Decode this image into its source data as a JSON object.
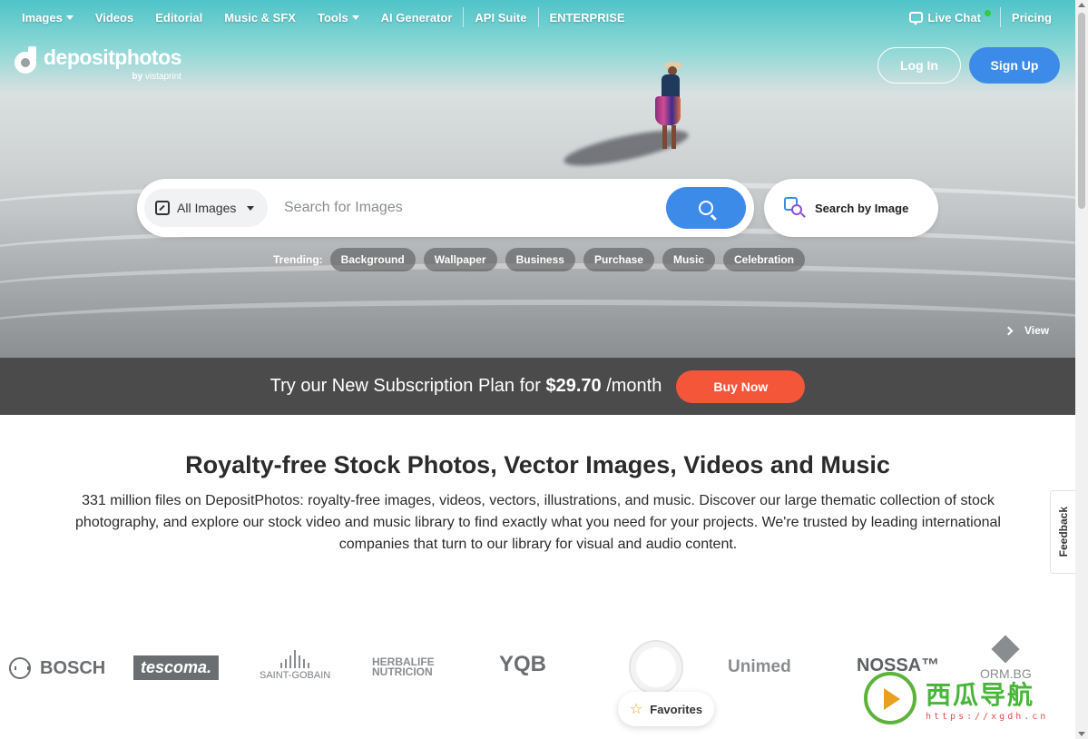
{
  "nav": {
    "items": [
      {
        "label": "Images",
        "dropdown": true
      },
      {
        "label": "Videos",
        "dropdown": false
      },
      {
        "label": "Editorial",
        "dropdown": false
      },
      {
        "label": "Music & SFX",
        "dropdown": false
      },
      {
        "label": "Tools",
        "dropdown": true
      },
      {
        "label": "AI Generator",
        "dropdown": false
      },
      {
        "label": "API Suite",
        "dropdown": false
      },
      {
        "label": "ENTERPRISE",
        "dropdown": false
      }
    ],
    "live_chat": "Live Chat",
    "pricing": "Pricing"
  },
  "logo": {
    "name": "depositphotos",
    "by": "by",
    "partner": "vistaprint"
  },
  "auth": {
    "login": "Log In",
    "signup": "Sign Up"
  },
  "search": {
    "scope": "All Images",
    "placeholder": "Search for Images",
    "by_image": "Search by Image"
  },
  "trending": {
    "label": "Trending:",
    "chips": [
      "Background",
      "Wallpaper",
      "Business",
      "Purchase",
      "Music",
      "Celebration"
    ]
  },
  "hero": {
    "view_label": "View"
  },
  "promo": {
    "text": "Try our New Subscription Plan for",
    "price": "$29.70",
    "period": "/month",
    "button": "Buy Now"
  },
  "main": {
    "headline": "Royalty-free Stock Photos, Vector Images, Videos and Music",
    "intro": "331 million files on DepositPhotos: royalty-free images, videos, vectors, illustrations, and music. Discover our large thematic collection of stock photography, and explore our stock video and music library to find exactly what you need for your projects. We're trusted by leading international companies that turn to our library for visual and audio content."
  },
  "brands": {
    "bosch": "BOSCH",
    "tescoma": "tescoma.",
    "saint_gobain": "SAINT-GOBAIN",
    "herbalife_1": "HERBALIFE",
    "herbalife_2": "NUTRICION",
    "yqb": "YQB",
    "unimed": "Unimed",
    "nossa": "NOSSA™",
    "ormbg": "ORM.BG"
  },
  "favorites": "Favorites",
  "feedback": "Feedback",
  "watermark": {
    "title": "西瓜导航",
    "url": "https://xgdh.cn"
  },
  "colors": {
    "accent": "#3d8be8",
    "promo_bar": "#4b4b4c",
    "buy_button": "#f4563a"
  }
}
